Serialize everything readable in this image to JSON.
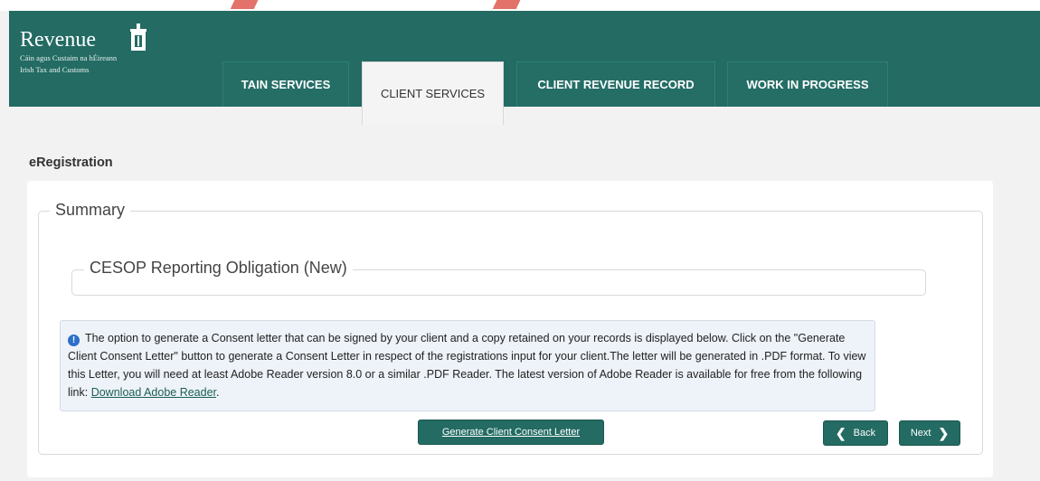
{
  "brand": {
    "name": "Revenue",
    "subtitle_line1": "Cáin agus Custaim na hÉireann",
    "subtitle_line2": "Irish Tax and Customs"
  },
  "tabs": [
    {
      "label": "TAIN SERVICES",
      "active": false
    },
    {
      "label": "CLIENT SERVICES",
      "active": true
    },
    {
      "label": "CLIENT REVENUE RECORD",
      "active": false
    },
    {
      "label": "WORK IN PROGRESS",
      "active": false
    }
  ],
  "page": {
    "title": "eRegistration"
  },
  "summary": {
    "legend": "Summary",
    "section_legend": "CESOP Reporting Obligation (New)"
  },
  "info": {
    "text": "The option to generate a Consent letter that can be signed by your client and a copy retained on your records is displayed below. Click on the \"Generate Client Consent Letter\" button to generate a Consent Letter in respect of the registrations input for your client.The letter will be generated in .PDF format. To view this Letter, you will need at least Adobe Reader version 8.0 or a similar .PDF Reader. The latest version of Adobe Reader is available for free from the following link: ",
    "link_label": "Download Adobe Reader",
    "suffix": "."
  },
  "buttons": {
    "generate": "Generate Client Consent Letter",
    "back": "Back",
    "next": "Next"
  },
  "colors": {
    "header": "#236b63",
    "accent": "#236b63"
  }
}
